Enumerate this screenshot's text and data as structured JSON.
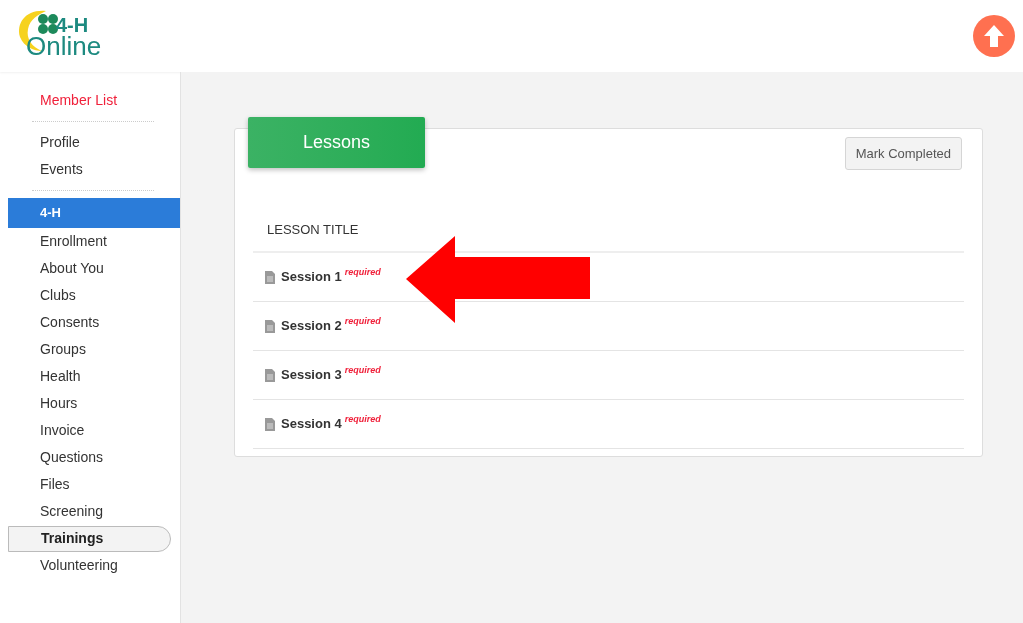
{
  "logo": {
    "line1": "4-H",
    "line2": "Online"
  },
  "sidebar": {
    "groups": [
      {
        "items": [
          {
            "label": "Member List",
            "kind": "back",
            "selected": false
          }
        ]
      },
      {
        "items": [
          {
            "label": "Profile",
            "kind": "link",
            "selected": false
          },
          {
            "label": "Events",
            "kind": "link",
            "selected": false
          }
        ]
      },
      {
        "items": [
          {
            "label": "4-H",
            "kind": "section",
            "selected": true
          },
          {
            "label": "Enrollment",
            "kind": "link",
            "selected": false
          },
          {
            "label": "About You",
            "kind": "link",
            "selected": false
          },
          {
            "label": "Clubs",
            "kind": "link",
            "selected": false
          },
          {
            "label": "Consents",
            "kind": "link",
            "selected": false
          },
          {
            "label": "Groups",
            "kind": "link",
            "selected": false
          },
          {
            "label": "Health",
            "kind": "link",
            "selected": false
          },
          {
            "label": "Hours",
            "kind": "link",
            "selected": false
          },
          {
            "label": "Invoice",
            "kind": "link",
            "selected": false
          },
          {
            "label": "Questions",
            "kind": "link",
            "selected": false
          },
          {
            "label": "Files",
            "kind": "link",
            "selected": false
          },
          {
            "label": "Screening",
            "kind": "link",
            "selected": false
          },
          {
            "label": "Trainings",
            "kind": "link",
            "selected": true
          },
          {
            "label": "Volunteering",
            "kind": "link",
            "selected": false
          }
        ]
      }
    ]
  },
  "card": {
    "title": "Lessons",
    "action": "Mark Completed",
    "column": "LESSON TITLE",
    "lessons": [
      {
        "title": "Session 1",
        "tag": "required"
      },
      {
        "title": "Session 2",
        "tag": "required"
      },
      {
        "title": "Session 3",
        "tag": "required"
      },
      {
        "title": "Session 4",
        "tag": "required"
      }
    ]
  }
}
